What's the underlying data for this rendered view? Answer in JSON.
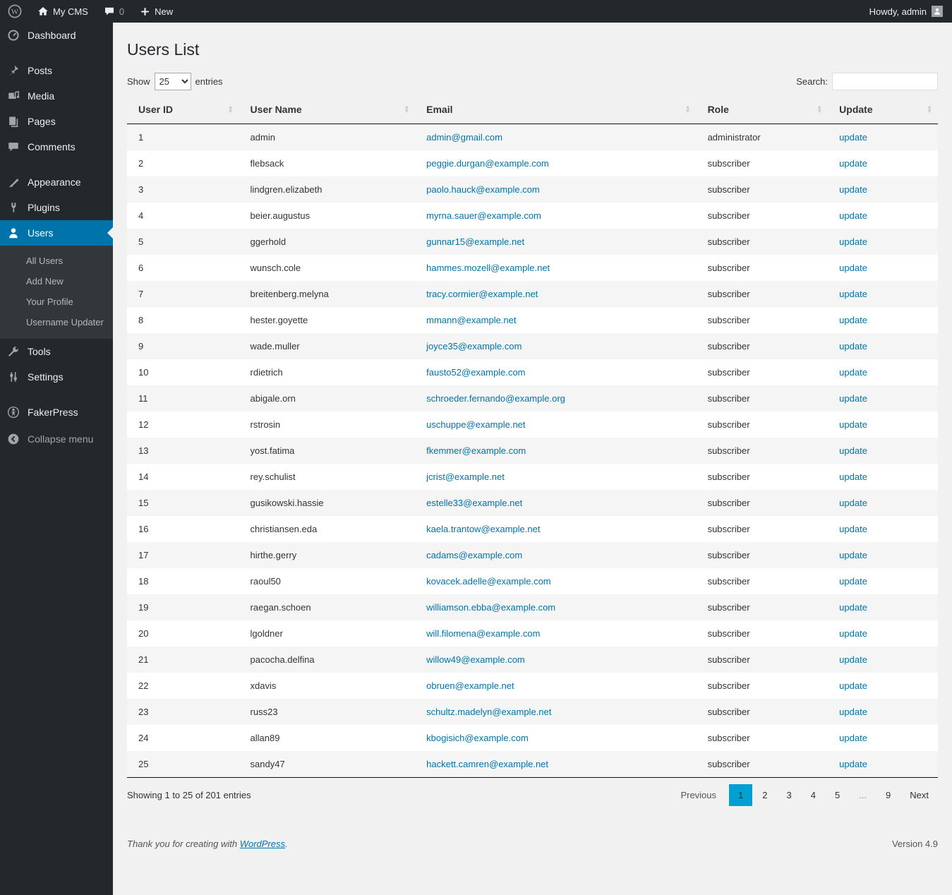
{
  "admin_bar": {
    "site_name": "My CMS",
    "comments_count": "0",
    "new_label": "New",
    "howdy_label": "Howdy, admin"
  },
  "sidebar": {
    "items": [
      {
        "label": "Dashboard"
      },
      {
        "label": "Posts"
      },
      {
        "label": "Media"
      },
      {
        "label": "Pages"
      },
      {
        "label": "Comments"
      },
      {
        "label": "Appearance"
      },
      {
        "label": "Plugins"
      },
      {
        "label": "Users"
      },
      {
        "label": "Tools"
      },
      {
        "label": "Settings"
      },
      {
        "label": "FakerPress"
      },
      {
        "label": "Collapse menu"
      }
    ],
    "active_item": "Users",
    "users_submenu": [
      {
        "label": "All Users"
      },
      {
        "label": "Add New"
      },
      {
        "label": "Your Profile"
      },
      {
        "label": "Username Updater"
      }
    ]
  },
  "page": {
    "title": "Users List"
  },
  "controls": {
    "show_label": "Show",
    "page_size": "25",
    "entries_label": "entries",
    "search_label": "Search:",
    "search_value": ""
  },
  "table": {
    "columns": [
      "User ID",
      "User Name",
      "Email",
      "Role",
      "Update"
    ],
    "update_label": "update",
    "rows": [
      {
        "id": "1",
        "username": "admin",
        "email": "admin@gmail.com",
        "role": "administrator"
      },
      {
        "id": "2",
        "username": "flebsack",
        "email": "peggie.durgan@example.com",
        "role": "subscriber"
      },
      {
        "id": "3",
        "username": "lindgren.elizabeth",
        "email": "paolo.hauck@example.com",
        "role": "subscriber"
      },
      {
        "id": "4",
        "username": "beier.augustus",
        "email": "myrna.sauer@example.com",
        "role": "subscriber"
      },
      {
        "id": "5",
        "username": "ggerhold",
        "email": "gunnar15@example.net",
        "role": "subscriber"
      },
      {
        "id": "6",
        "username": "wunsch.cole",
        "email": "hammes.mozell@example.net",
        "role": "subscriber"
      },
      {
        "id": "7",
        "username": "breitenberg.melyna",
        "email": "tracy.cormier@example.net",
        "role": "subscriber"
      },
      {
        "id": "8",
        "username": "hester.goyette",
        "email": "mmann@example.net",
        "role": "subscriber"
      },
      {
        "id": "9",
        "username": "wade.muller",
        "email": "joyce35@example.com",
        "role": "subscriber"
      },
      {
        "id": "10",
        "username": "rdietrich",
        "email": "fausto52@example.com",
        "role": "subscriber"
      },
      {
        "id": "11",
        "username": "abigale.orn",
        "email": "schroeder.fernando@example.org",
        "role": "subscriber"
      },
      {
        "id": "12",
        "username": "rstrosin",
        "email": "uschuppe@example.net",
        "role": "subscriber"
      },
      {
        "id": "13",
        "username": "yost.fatima",
        "email": "fkemmer@example.com",
        "role": "subscriber"
      },
      {
        "id": "14",
        "username": "rey.schulist",
        "email": "jcrist@example.net",
        "role": "subscriber"
      },
      {
        "id": "15",
        "username": "gusikowski.hassie",
        "email": "estelle33@example.net",
        "role": "subscriber"
      },
      {
        "id": "16",
        "username": "christiansen.eda",
        "email": "kaela.trantow@example.net",
        "role": "subscriber"
      },
      {
        "id": "17",
        "username": "hirthe.gerry",
        "email": "cadams@example.com",
        "role": "subscriber"
      },
      {
        "id": "18",
        "username": "raoul50",
        "email": "kovacek.adelle@example.com",
        "role": "subscriber"
      },
      {
        "id": "19",
        "username": "raegan.schoen",
        "email": "williamson.ebba@example.com",
        "role": "subscriber"
      },
      {
        "id": "20",
        "username": "lgoldner",
        "email": "will.filomena@example.com",
        "role": "subscriber"
      },
      {
        "id": "21",
        "username": "pacocha.delfina",
        "email": "willow49@example.com",
        "role": "subscriber"
      },
      {
        "id": "22",
        "username": "xdavis",
        "email": "obruen@example.net",
        "role": "subscriber"
      },
      {
        "id": "23",
        "username": "russ23",
        "email": "schultz.madelyn@example.net",
        "role": "subscriber"
      },
      {
        "id": "24",
        "username": "allan89",
        "email": "kbogisich@example.com",
        "role": "subscriber"
      },
      {
        "id": "25",
        "username": "sandy47",
        "email": "hackett.camren@example.net",
        "role": "subscriber"
      }
    ]
  },
  "pagination": {
    "info": "Showing 1 to 25 of 201 entries",
    "previous_label": "Previous",
    "next_label": "Next",
    "pages": [
      "1",
      "2",
      "3",
      "4",
      "5",
      "...",
      "9"
    ],
    "active_page": "1"
  },
  "footer": {
    "thanks_prefix": "Thank you for creating with ",
    "wordpress_link": "WordPress",
    "thanks_suffix": ".",
    "version": "Version 4.9"
  },
  "colors": {
    "accent_blue": "#0073aa",
    "active_page_bg": "#00a0d2",
    "admin_dark": "#23282d",
    "page_bg": "#f1f1f1"
  }
}
